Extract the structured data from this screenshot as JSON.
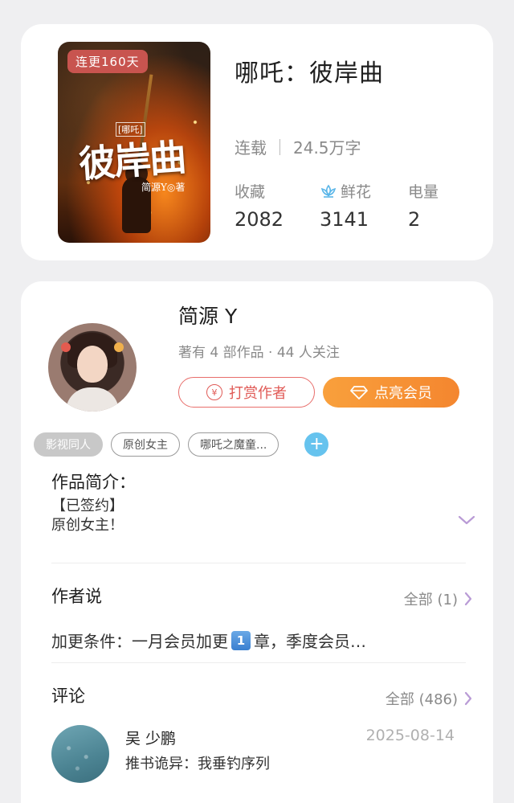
{
  "book": {
    "cover_badge": "连更160天",
    "cover_small": "[哪吒]",
    "cover_title": "彼岸曲",
    "cover_author": "简源Y◎著",
    "title": "哪吒：彼岸曲",
    "status": "连载",
    "words": "24.5万字",
    "stats": {
      "favorites_label": "收藏",
      "favorites_value": "2082",
      "flowers_label": "鲜花",
      "flowers_value": "3141",
      "power_label": "电量",
      "power_value": "2"
    }
  },
  "author": {
    "name": "简源 Y",
    "summary": "著有 4 部作品 · 44 人关注",
    "reward_button": "打赏作者",
    "vip_button": "点亮会员",
    "tags": [
      "影视同人",
      "原创女主",
      "哪吒之魔童..."
    ]
  },
  "intro": {
    "title": "作品简介：",
    "line1": "【已签约】",
    "line2": "原创女主！"
  },
  "author_say": {
    "title": "作者说",
    "more": "全部 (1)",
    "text_before": "加更条件：一月会员加更",
    "num_key": "1",
    "text_after": "章，季度会员…"
  },
  "comments": {
    "title": "评论",
    "more": "全部 (486)",
    "items": [
      {
        "user": "吴 少鹏",
        "date": "2025-08-14",
        "text": "推书诡异：我垂钓序列"
      }
    ]
  },
  "colors": {
    "accent_red": "#e05a56",
    "accent_orange": "#f4862f",
    "tag_add_blue": "#66c3ee",
    "chevron_purple": "#b99bd6"
  }
}
